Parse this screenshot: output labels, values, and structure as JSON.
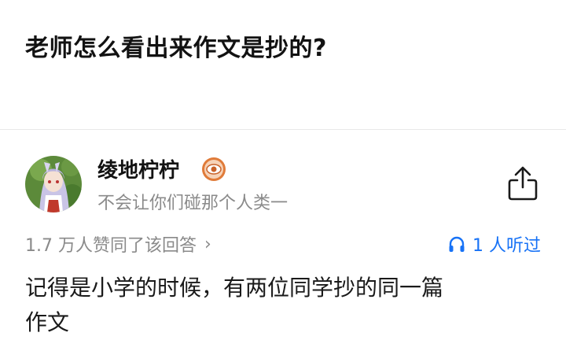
{
  "question": {
    "title": "老师怎么看出来作文是抄的?"
  },
  "author": {
    "name": "绫地柠柠",
    "bio": "不会让你们碰那个人类一",
    "avatar_icon": "anime-avatar",
    "badge_icon": "eye-badge-icon"
  },
  "stats": {
    "approvals": "1.7 万人赞同了该回答",
    "approvals_chevron": "›",
    "listeners": "1 人听过",
    "listeners_icon": "headphones-icon"
  },
  "answer": {
    "line1": "记得是小学的时候，有两位同学抄的同一篇",
    "line2": "作文"
  },
  "colors": {
    "accent": "#1772f6",
    "muted": "#8a8a8a",
    "badge": "#e07b39"
  }
}
